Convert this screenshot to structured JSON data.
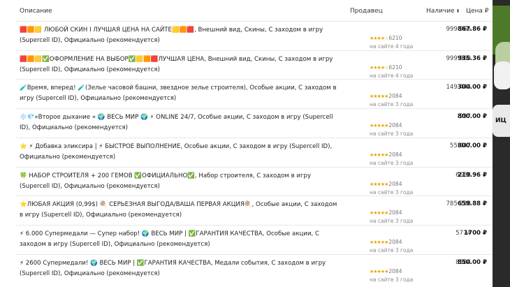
{
  "header": {
    "description": "Описание",
    "seller": "Продавец",
    "stock": "Наличие",
    "price": "Цена ₽"
  },
  "rows": [
    {
      "desc": "🟥🟧🟨 ЛЮБОЙ СКИН I ЛУЧШАЯ ЦЕНА НА САЙТЕ🟨🟧🟥, Внешний вид, Скины, С заходом в игру (Supercell ID), Официально (рекомендуется)",
      "stars": "★★★★☆",
      "rating_count": "6210",
      "since": "на сайте 4 года",
      "stock": "999 966",
      "price": "867.86 ₽"
    },
    {
      "desc": "🟥🟧🟨✅ОФОРМЛЕНИЕ НА ВЫБОР✅🟨🟧🟥ЛУЧШАЯ ЦЕНА, Внешний вид, Скины, С заходом в игру (Supercell ID), Официально (рекомендуется)",
      "stars": "★★★★☆",
      "rating_count": "6210",
      "since": "на сайте 4 года",
      "stock": "999 960",
      "price": "935.36 ₽"
    },
    {
      "desc": "🧪Время, вперед! 🧪(Зелье часовой башни, звездное зелье строителя), Особые акции, С заходом в игру (Supercell ID), Официально (рекомендуется)",
      "stars": "★★★★★",
      "rating_count": "2084",
      "since": "на сайте 3 года",
      "stock": "149 444",
      "price": "300.00 ₽"
    },
    {
      "desc": "❄️💎«Второе дыхание » 🌍 ВЕСЬ МИР 🌍 ⚡ ONLINE 24/7, Особые акции, С заходом в игру (Supercell ID), Официально (рекомендуется)",
      "stars": "★★★★★",
      "rating_count": "2084",
      "since": "на сайте 3 года",
      "stock": "997",
      "price": "800.00 ₽"
    },
    {
      "desc": "⭐ ⚡ Добавка эликсира | ⚡ БЫСТРОЕ ВЫПОЛНЕНИЕ, Особые акции, С заходом в игру (Supercell ID), Официально (рекомендуется)",
      "stars": "★★★★★",
      "rating_count": "2084",
      "since": "на сайте 3 года",
      "stock": "55 447",
      "price": "800.00 ₽"
    },
    {
      "desc": "🍀 НАБОР СТРОИТЕЛЯ + 200 ГЕМОВ ✅ОФИЦИАЛЬНО✅, Набор строителя, С заходом в игру (Supercell ID), Официально (рекомендуется)",
      "stars": "★★★★★",
      "rating_count": "2084",
      "since": "на сайте 3 года",
      "stock": "6658",
      "price": "219.96 ₽"
    },
    {
      "desc": "⭐ЛЮБАЯ АКЦИЯ (0,99$) 🍭 СЕРЬЕЗНАЯ ВЫГОДА/ВАША ПЕРВАЯ АКЦИЯ🍭, Особые акции, С заходом в игру (Supercell ID), Официально (рекомендуется)",
      "stars": "★★★★★",
      "rating_count": "2084",
      "since": "на сайте 3 года",
      "stock": "785 238",
      "price": "659.88 ₽"
    },
    {
      "desc": "⚡ 6.000 Супермедали — Супер набор! 🌍 ВЕСЬ МИР | ✅ГАРАНТИЯ КАЧЕСТВА, Особые акции, С заходом в игру (Supercell ID), Официально (рекомендуется)",
      "stars": "★★★★★",
      "rating_count": "2084",
      "since": "на сайте 3 года",
      "stock": "5774",
      "price": "1700 ₽"
    },
    {
      "desc": "⚡ 2600 Супермедали! 🌍 ВЕСЬ МИР | ✅ГАРАНТИЯ КАЧЕСТВА, Медали события, С заходом в игру (Supercell ID), Официально (рекомендуется)",
      "stars": "★★★★★",
      "rating_count": "2084",
      "since": "на сайте 3 года",
      "stock": "8584",
      "price": "850.00 ₽"
    }
  ],
  "side_banner_text": "ИЦ"
}
